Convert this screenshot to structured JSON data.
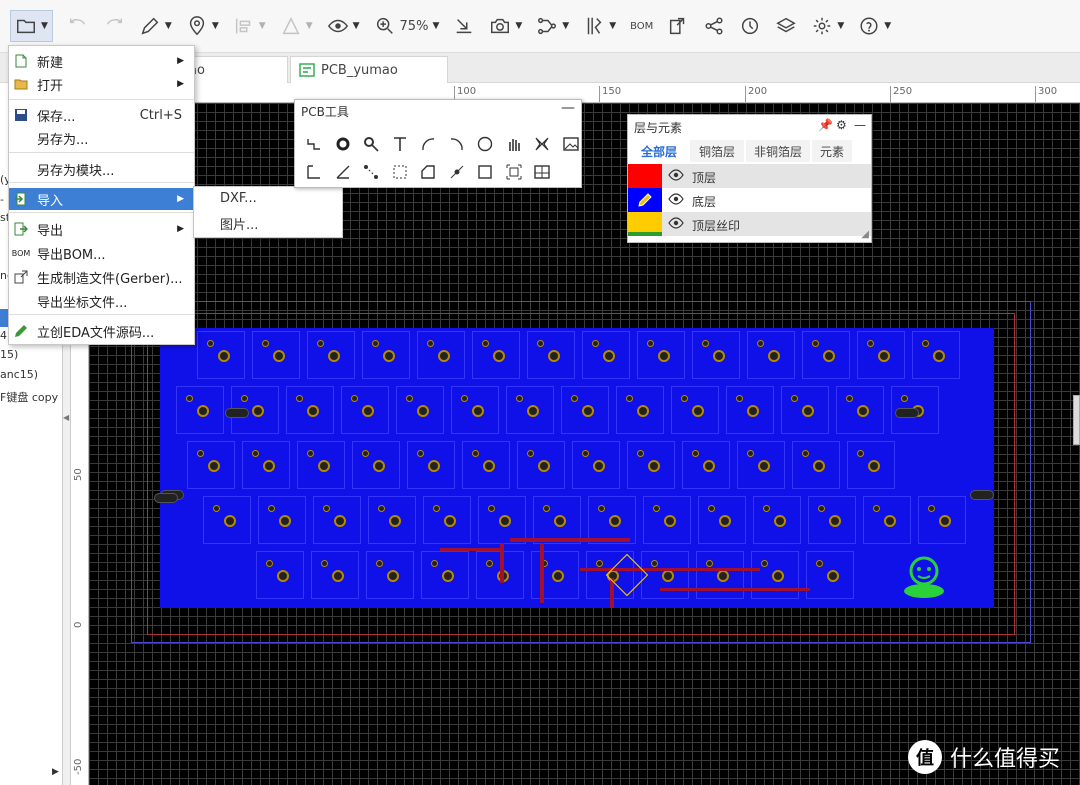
{
  "toolbar": {
    "zoom": "75%",
    "bom_label": "BOM"
  },
  "tabs": [
    {
      "label": "ao"
    },
    {
      "label": "PCB_yumao"
    }
  ],
  "sidebar": {
    "fragments": [
      "(y",
      "- r",
      "st",
      "nc",
      "4",
      "15)",
      "anc15)",
      "F键盘 copy"
    ]
  },
  "rulers": {
    "top": [
      "100",
      "150",
      "200",
      "250",
      "300"
    ],
    "left": [
      "50",
      "0",
      "-50"
    ]
  },
  "file_menu": {
    "items": [
      {
        "icon": "new-file-icon",
        "label": "新建",
        "shortcut": "",
        "submenu": true
      },
      {
        "icon": "open-folder-icon",
        "label": "打开",
        "shortcut": "",
        "submenu": true
      },
      {
        "icon": "save-icon",
        "label": "保存...",
        "shortcut": "Ctrl+S",
        "submenu": false
      },
      {
        "icon": "",
        "label": "另存为...",
        "shortcut": "",
        "submenu": false
      },
      {
        "icon": "",
        "label": "另存为模块...",
        "shortcut": "",
        "submenu": false
      },
      {
        "icon": "import-icon",
        "label": "导入",
        "shortcut": "",
        "submenu": true
      },
      {
        "icon": "export-icon",
        "label": "导出",
        "shortcut": "",
        "submenu": true
      },
      {
        "icon": "bom-icon",
        "label": "导出BOM...",
        "shortcut": "",
        "submenu": false
      },
      {
        "icon": "gerber-icon",
        "label": "生成制造文件(Gerber)...",
        "shortcut": "",
        "submenu": false
      },
      {
        "icon": "",
        "label": "导出坐标文件...",
        "shortcut": "",
        "submenu": false
      },
      {
        "icon": "pencil-icon",
        "label": "立创EDA文件源码...",
        "shortcut": "",
        "submenu": false
      }
    ],
    "bom_icon_text": "BOM"
  },
  "import_submenu": {
    "items": [
      "DXF...",
      "图片..."
    ]
  },
  "pcb_tools": {
    "title": "PCB工具"
  },
  "layers_panel": {
    "title": "层与元素",
    "tabs": [
      "全部层",
      "铜箔层",
      "非铜箔层",
      "元素"
    ],
    "active_tab": "全部层",
    "layers": [
      {
        "name": "顶层",
        "color": "#ff0000",
        "active": false
      },
      {
        "name": "底层",
        "color": "#0000ff",
        "active": true
      },
      {
        "name": "顶层丝印",
        "color": "#ffcc00",
        "active": false
      }
    ]
  },
  "watermark": {
    "icon_text": "值",
    "text": "什么值得买"
  },
  "colors": {
    "accent": "#3e7fd6",
    "board": "#1010e8",
    "canvas": "#000000"
  }
}
